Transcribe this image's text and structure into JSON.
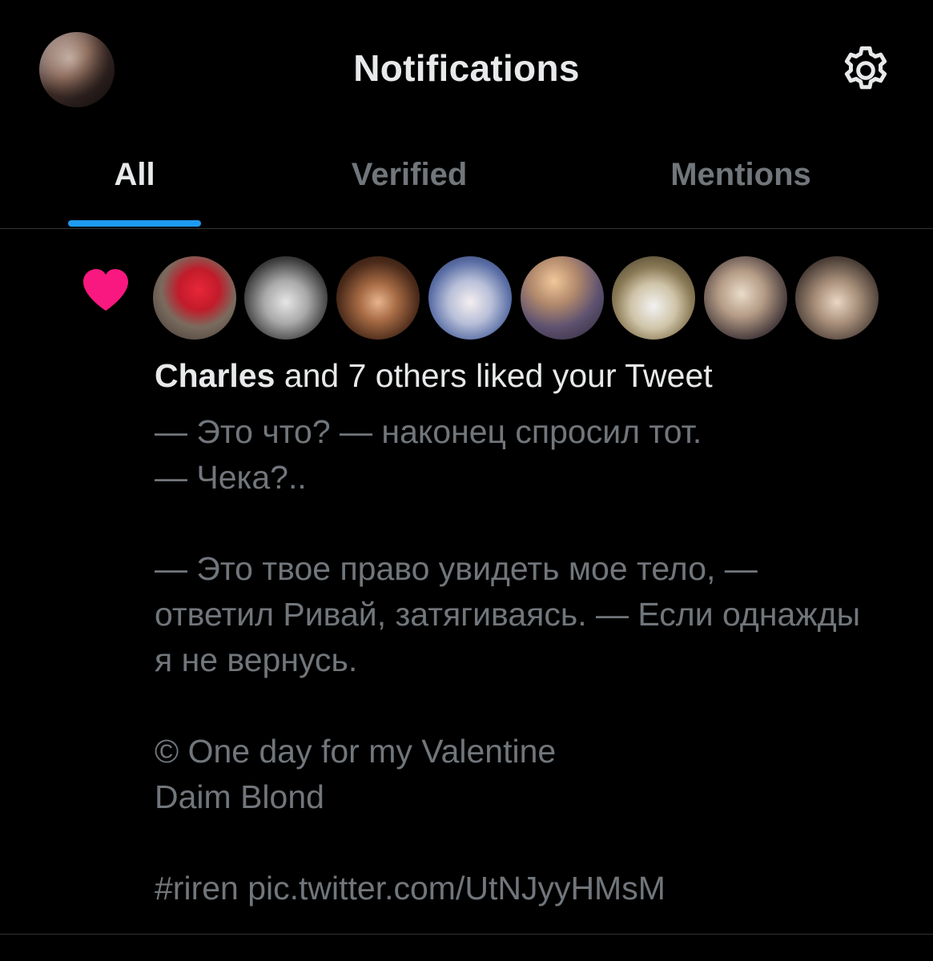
{
  "header": {
    "title": "Notifications",
    "avatar_icon": "profile-avatar",
    "settings_icon": "gear-icon"
  },
  "tabs": [
    {
      "label": "All",
      "active": true
    },
    {
      "label": "Verified",
      "active": false
    },
    {
      "label": "Mentions",
      "active": false
    }
  ],
  "notification": {
    "icon": "heart-icon",
    "icon_color": "#f91880",
    "liker_count": 8,
    "actor": "Charles",
    "summary_rest": " and 7 others liked your Tweet",
    "tweet_text": "— Это что? — наконец спросил тот.\n— Чека?..\n\n— Это твое право увидеть мое тело, — ответил Ривай, затягиваясь. — Если однажды я не вернусь.\n\n© One day for my Valentine\nDaim Blond\n\n#riren pic.twitter.com/UtNJyyHMsM"
  },
  "colors": {
    "background": "#000000",
    "text_primary": "#e7e9ea",
    "text_secondary": "#71767b",
    "accent": "#1d9bf0",
    "like": "#f91880",
    "divider": "#2f3336"
  }
}
